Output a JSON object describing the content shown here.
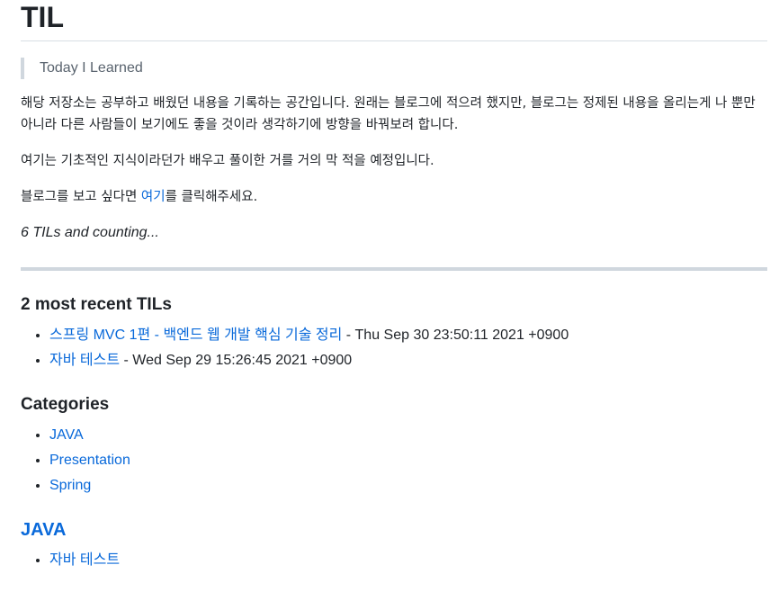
{
  "page": {
    "title": "TIL",
    "blockquote": "Today I Learned",
    "intro": "해당 저장소는 공부하고 배웠던 내용을 기록하는 공간입니다. 원래는 블로그에 적으려 했지만, 블로그는 정제된 내용을 올리는게 나 뿐만 아니라 다른 사람들이 보기에도 좋을 것이라 생각하기에 방향을 바꿔보려 합니다.",
    "basics": "여기는 기초적인 지식이라던가 배우고 풀이한 거를 거의 막 적을 예정입니다.",
    "blog_prefix": "블로그를 보고 싶다면 ",
    "blog_link": "여기",
    "blog_suffix": "를 클릭해주세요.",
    "counting": "6 TILs and counting..."
  },
  "recent": {
    "heading": "2 most recent TILs",
    "items": [
      {
        "title": "스프링 MVC 1편 - 백엔드 웹 개발 핵심 기술 정리",
        "date": " - Thu Sep 30 23:50:11 2021 +0900"
      },
      {
        "title": "자바 테스트",
        "date": " - Wed Sep 29 15:26:45 2021 +0900"
      }
    ]
  },
  "categories": {
    "heading": "Categories",
    "items": [
      "JAVA",
      "Presentation",
      "Spring"
    ]
  },
  "java": {
    "heading": "JAVA",
    "items": [
      "자바 테스트"
    ]
  },
  "colors": {
    "link": "#0969da",
    "text": "#1f2328",
    "muted": "#59636e",
    "rule": "#d0d7de"
  }
}
